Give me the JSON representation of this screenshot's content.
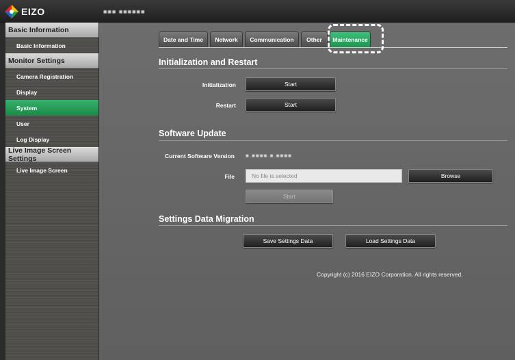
{
  "header": {
    "brand": "EIZO",
    "device_name": "■■■ ■■■■■■"
  },
  "sidebar": {
    "sections": [
      {
        "title": "Basic Information",
        "items": [
          {
            "label": "Basic Information"
          }
        ]
      },
      {
        "title": "Monitor Settings",
        "items": [
          {
            "label": "Camera Registration"
          },
          {
            "label": "Display"
          },
          {
            "label": "System",
            "active": true
          },
          {
            "label": "User"
          },
          {
            "label": "Log Display"
          }
        ]
      },
      {
        "title": "Live Image Screen Settings",
        "items": [
          {
            "label": "Live Image Screen"
          }
        ]
      }
    ]
  },
  "tabs": [
    {
      "label": "Date and Time"
    },
    {
      "label": "Network"
    },
    {
      "label": "Communication"
    },
    {
      "label": "Other"
    },
    {
      "label": "Maintenance",
      "active": true
    }
  ],
  "init": {
    "title": "Initialization and Restart",
    "initialization_label": "Initialization",
    "initialization_button": "Start",
    "restart_label": "Restart",
    "restart_button": "Start"
  },
  "update": {
    "title": "Software Update",
    "version_label": "Current Software Version",
    "version_value": "■.■■■■.■.■■■■",
    "file_label": "File",
    "file_placeholder": "No file is selected",
    "browse_button": "Browse",
    "start_button": "Start"
  },
  "migration": {
    "title": "Settings Data Migration",
    "save_button": "Save Settings Data",
    "load_button": "Load Settings Data"
  },
  "footer": {
    "copyright": "Copyright (c) 2016 EIZO Corporation. All rights reserved."
  },
  "colors": {
    "accent_green": "#1d9450",
    "highlight": "#ffffff"
  }
}
